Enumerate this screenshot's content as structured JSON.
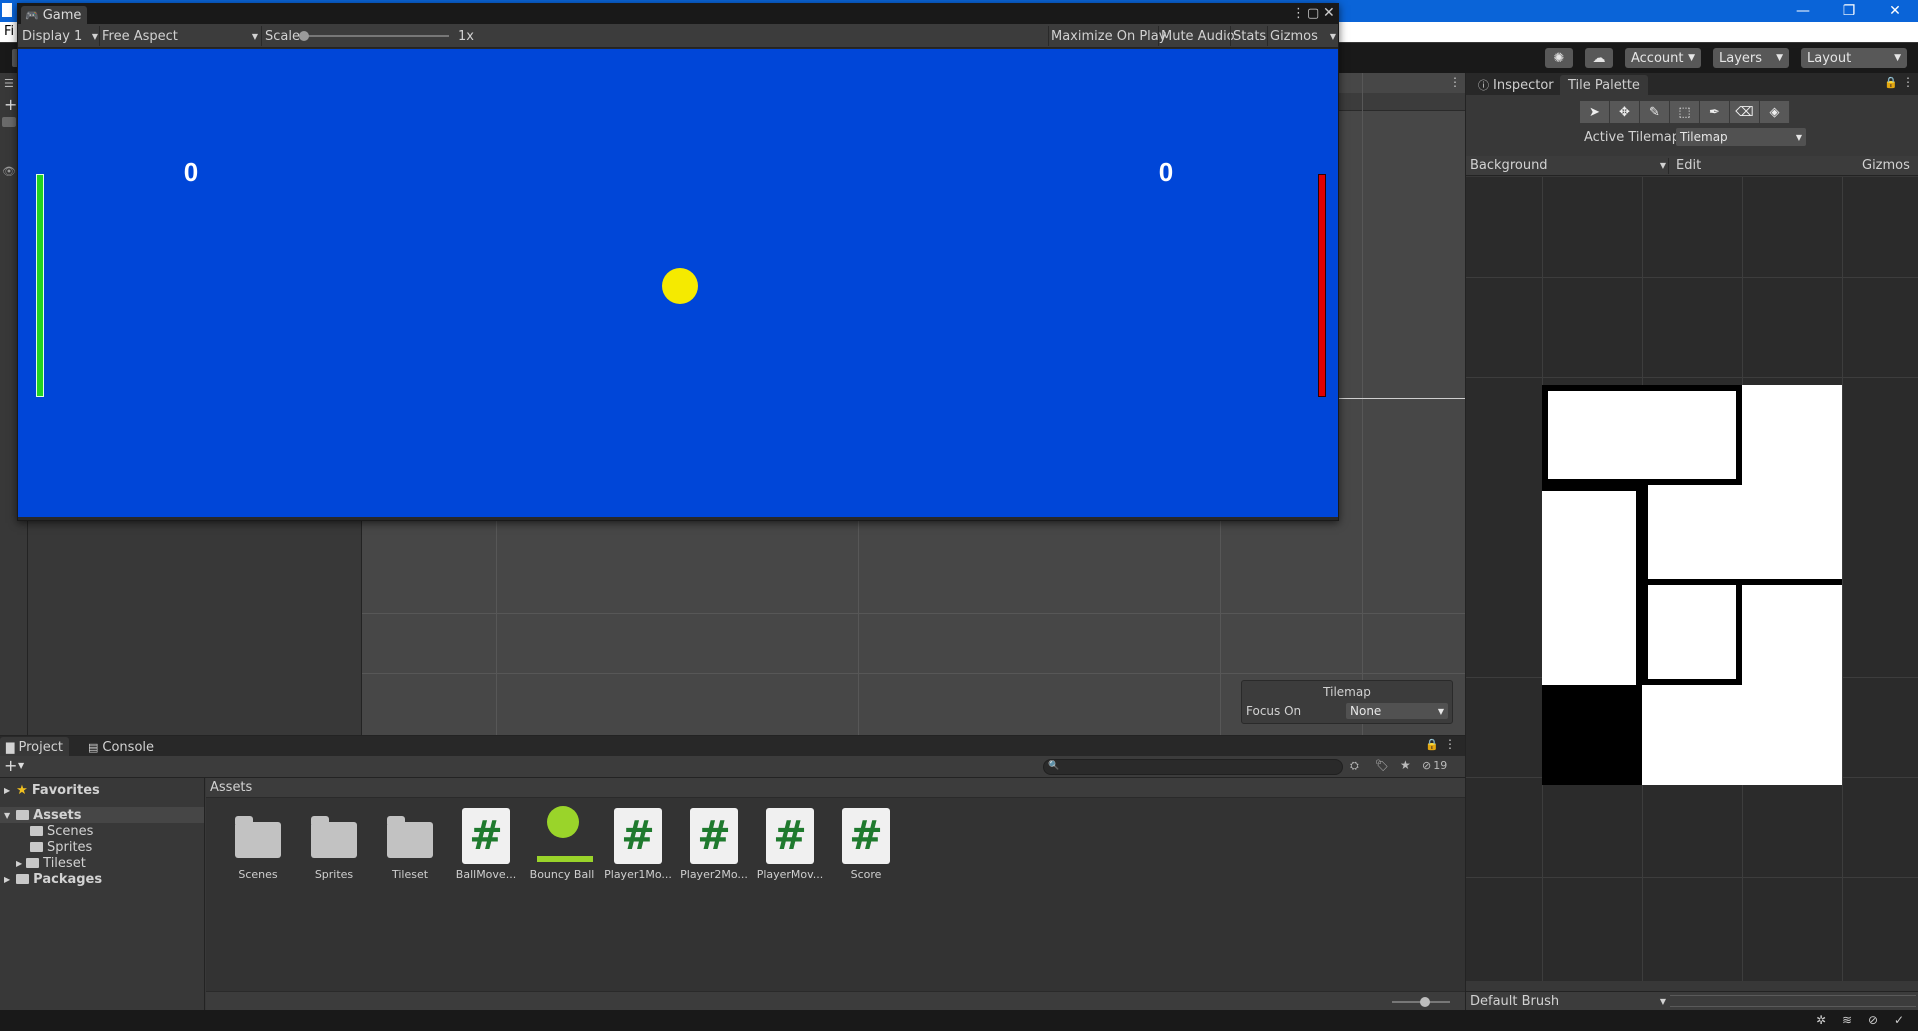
{
  "os": {
    "menu_first_letter": "Fi",
    "window_buttons": [
      "—",
      "❐",
      "✕"
    ]
  },
  "toolbar": {
    "account_label": "Account",
    "layers_label": "Layers",
    "layout_label": "Layout"
  },
  "game": {
    "tab_label": "Game",
    "display_label": "Display 1",
    "aspect_label": "Free Aspect",
    "scale_label": "Scale",
    "scale_value": "1x",
    "maximize_label": "Maximize On Play",
    "mute_label": "Mute Audio",
    "stats_label": "Stats",
    "gizmos_label": "Gizmos",
    "score_left": "0",
    "score_right": "0",
    "colors": {
      "background": "#0046d8",
      "paddle_left": "#21d321",
      "paddle_right": "#e00000",
      "ball": "#f5ea00"
    }
  },
  "scene": {
    "overlay_title": "Tilemap",
    "focus_label": "Focus On",
    "focus_value": "None"
  },
  "right_panel": {
    "tab_inspector": "Inspector",
    "tab_tile_palette": "Tile Palette",
    "active_tilemap_label": "Active Tilemap",
    "active_tilemap_value": "Tilemap",
    "palette_name": "Background",
    "edit_label": "Edit",
    "gizmos_label": "Gizmos",
    "brush_label": "Default Brush"
  },
  "project": {
    "tab_project": "Project",
    "tab_console": "Console",
    "hidden_count": "19",
    "tree": {
      "favorites": "Favorites",
      "assets": "Assets",
      "scenes": "Scenes",
      "sprites": "Sprites",
      "tileset": "Tileset",
      "packages": "Packages"
    },
    "breadcrumb": "Assets",
    "assets": [
      {
        "name": "Scenes",
        "kind": "folder"
      },
      {
        "name": "Sprites",
        "kind": "folder"
      },
      {
        "name": "Tileset",
        "kind": "folder"
      },
      {
        "name": "BallMove...",
        "kind": "script"
      },
      {
        "name": "Bouncy Ball",
        "kind": "physics-material"
      },
      {
        "name": "Player1Mo...",
        "kind": "script"
      },
      {
        "name": "Player2Mo...",
        "kind": "script"
      },
      {
        "name": "PlayerMov...",
        "kind": "script"
      },
      {
        "name": "Score",
        "kind": "script"
      }
    ],
    "script_glyph": "#"
  }
}
